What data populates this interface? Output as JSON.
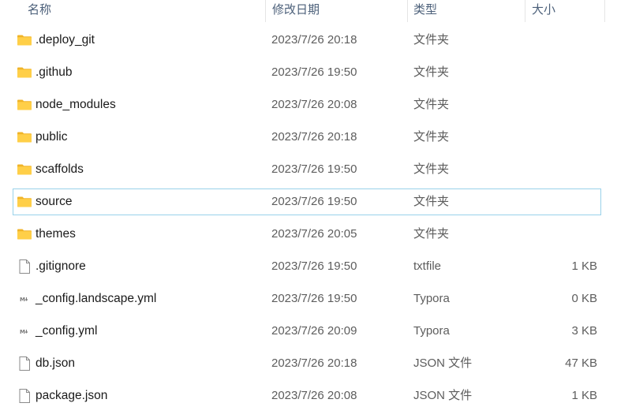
{
  "columns": {
    "name": "名称",
    "date": "修改日期",
    "type": "类型",
    "size": "大小"
  },
  "rows": [
    {
      "name": ".deploy_git",
      "date": "2023/7/26 20:18",
      "type": "文件夹",
      "size": "",
      "icon": "folder-icon"
    },
    {
      "name": ".github",
      "date": "2023/7/26 19:50",
      "type": "文件夹",
      "size": "",
      "icon": "folder-icon"
    },
    {
      "name": "node_modules",
      "date": "2023/7/26 20:08",
      "type": "文件夹",
      "size": "",
      "icon": "folder-icon"
    },
    {
      "name": "public",
      "date": "2023/7/26 20:18",
      "type": "文件夹",
      "size": "",
      "icon": "folder-icon"
    },
    {
      "name": "scaffolds",
      "date": "2023/7/26 19:50",
      "type": "文件夹",
      "size": "",
      "icon": "folder-icon"
    },
    {
      "name": "source",
      "date": "2023/7/26 19:50",
      "type": "文件夹",
      "size": "",
      "icon": "folder-icon"
    },
    {
      "name": "themes",
      "date": "2023/7/26 20:05",
      "type": "文件夹",
      "size": "",
      "icon": "folder-icon"
    },
    {
      "name": ".gitignore",
      "date": "2023/7/26 19:50",
      "type": "txtfile",
      "size": "1 KB",
      "icon": "file-icon"
    },
    {
      "name": "_config.landscape.yml",
      "date": "2023/7/26 19:50",
      "type": "Typora",
      "size": "0 KB",
      "icon": "typora-file-icon"
    },
    {
      "name": "_config.yml",
      "date": "2023/7/26 20:09",
      "type": "Typora",
      "size": "3 KB",
      "icon": "typora-file-icon"
    },
    {
      "name": "db.json",
      "date": "2023/7/26 20:18",
      "type": "JSON 文件",
      "size": "47 KB",
      "icon": "file-icon"
    },
    {
      "name": "package.json",
      "date": "2023/7/26 20:08",
      "type": "JSON 文件",
      "size": "1 KB",
      "icon": "file-icon"
    }
  ],
  "focused_row": "source",
  "colors": {
    "folder": "#ffcf48",
    "folder_dark": "#f0b429",
    "focus_border": "#99d1ea",
    "header_text": "#4c607a"
  }
}
